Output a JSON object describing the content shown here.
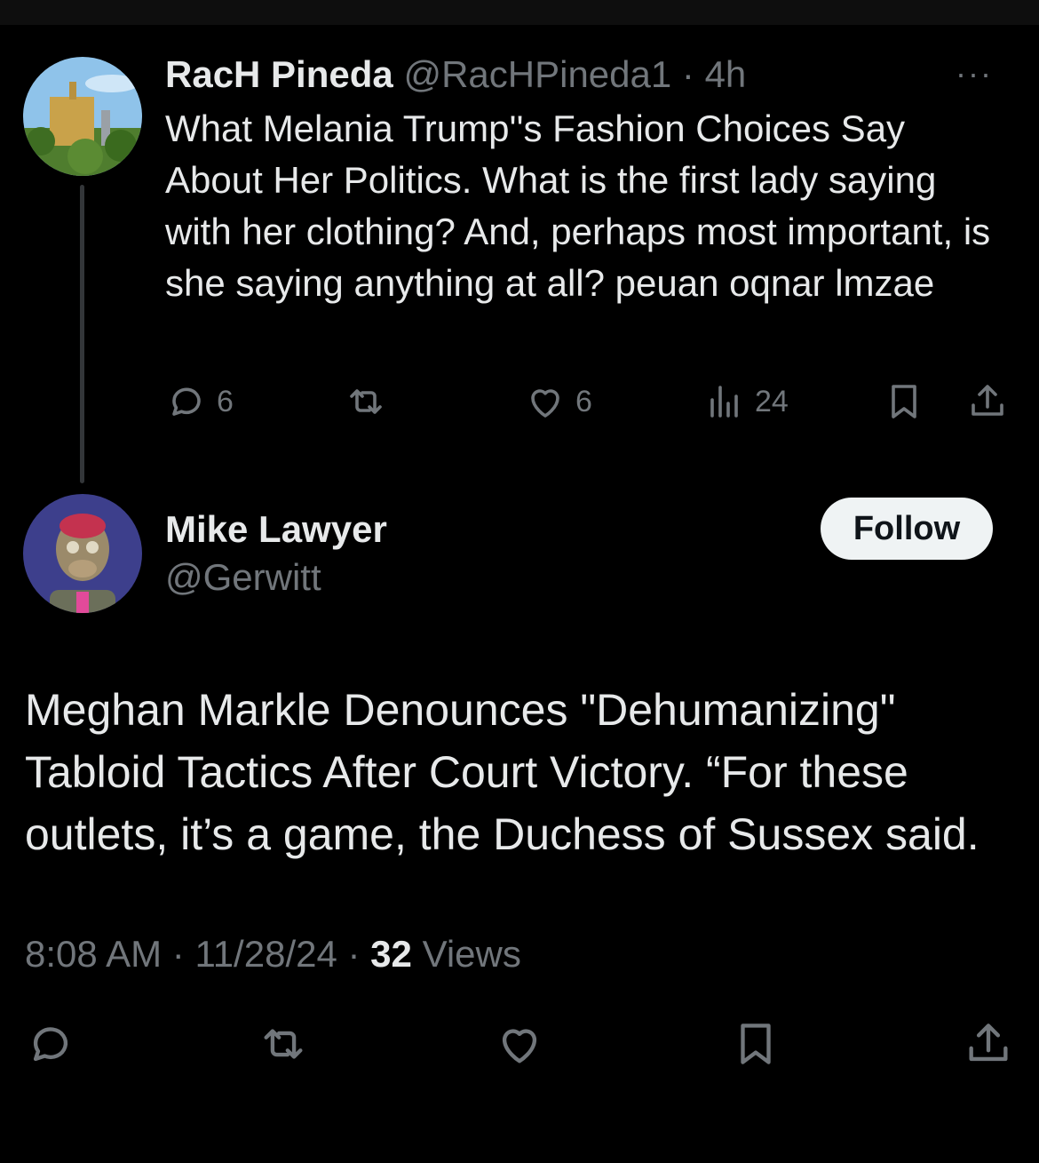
{
  "tweet1": {
    "name": "RacH Pineda",
    "handle": "@RacHPineda1",
    "separator": "·",
    "time": "4h",
    "more": "···",
    "text": "What Melania Trump''s Fashion Choices Say About Her Politics. What is the first lady saying with her clothing? And, perhaps most important, is she saying anything at all? peuan oqnar lmzae",
    "replies": "6",
    "likes": "6",
    "views": "24",
    "avatar_icon": "landscape-building-avatar"
  },
  "tweet2": {
    "name": "Mike Lawyer",
    "handle": "@Gerwitt",
    "follow_label": "Follow",
    "text": "Meghan Markle Denounces \"Dehumanizing\" Tabloid Tactics After Court Victory. “For these outlets, it’s a game, the Duchess of Sussex said.",
    "time": "8:08 AM",
    "date": "11/28/24",
    "views_count": "32",
    "views_label": "Views",
    "separator": "·",
    "avatar_icon": "ape-nft-avatar"
  },
  "colors": {
    "background": "#000000",
    "text": "#e7e9ea",
    "muted": "#71767b",
    "follow_bg": "#eff3f4"
  }
}
